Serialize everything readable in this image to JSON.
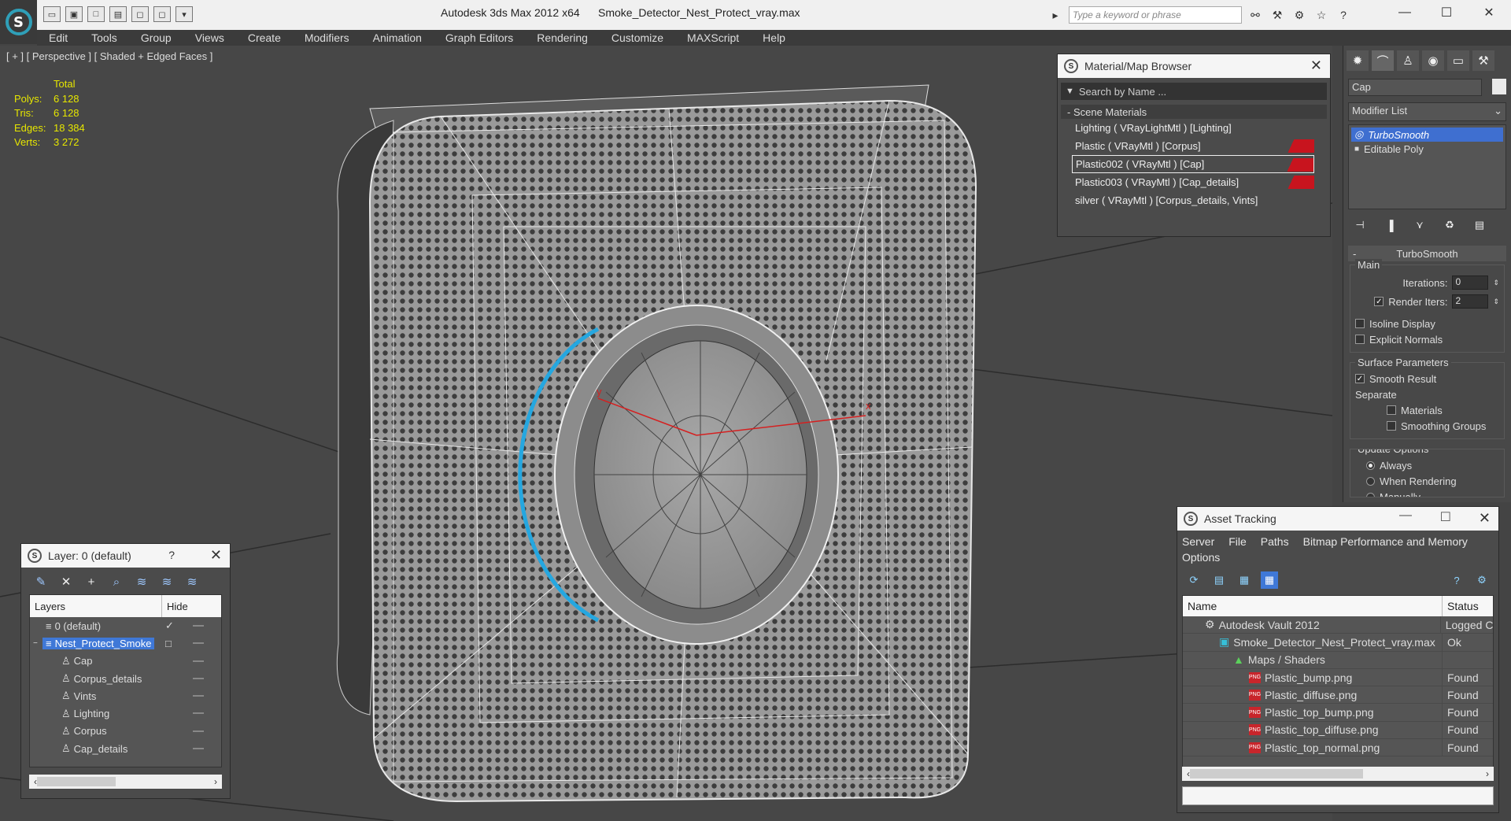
{
  "titlebar": {
    "app": "Autodesk 3ds Max  2012 x64",
    "file": "Smoke_Detector_Nest_Protect_vray.max",
    "search_placeholder": "Type a keyword or phrase",
    "logo_letter": "S"
  },
  "menu": [
    "Edit",
    "Tools",
    "Group",
    "Views",
    "Create",
    "Modifiers",
    "Animation",
    "Graph Editors",
    "Rendering",
    "Customize",
    "MAXScript",
    "Help"
  ],
  "viewport": {
    "label": "[ + ] [ Perspective ] [ Shaded + Edged Faces ]",
    "stats_header": "Total",
    "stats": [
      {
        "k": "Polys:",
        "v": "6 128"
      },
      {
        "k": "Tris:",
        "v": "6 128"
      },
      {
        "k": "Edges:",
        "v": "18 384"
      },
      {
        "k": "Verts:",
        "v": "3 272"
      }
    ],
    "axis_x": "x",
    "axis_y": "y"
  },
  "material_browser": {
    "title": "Material/Map Browser",
    "search_placeholder": "Search by Name ...",
    "section": "- Scene Materials",
    "materials": [
      {
        "label": "Lighting  ( VRayLightMtl )  [Lighting]",
        "swatch": false,
        "selected": false
      },
      {
        "label": "Plastic  ( VRayMtl )  [Corpus]",
        "swatch": true,
        "selected": false
      },
      {
        "label": "Plastic002  ( VRayMtl )  [Cap]",
        "swatch": true,
        "selected": true
      },
      {
        "label": "Plastic003  ( VRayMtl )  [Cap_details]",
        "swatch": true,
        "selected": false
      },
      {
        "label": "silver  ( VRayMtl )  [Corpus_details, Vints]",
        "swatch": false,
        "selected": false
      }
    ]
  },
  "command_panel": {
    "object_name": "Cap",
    "modifier_list": "Modifier List",
    "stack": [
      {
        "label": "TurboSmooth",
        "active": true
      },
      {
        "label": "Editable Poly",
        "active": false
      }
    ],
    "rollout_title": "TurboSmooth",
    "main_label": "Main",
    "iterations_label": "Iterations:",
    "iterations_value": "0",
    "render_iters_label": "Render Iters:",
    "render_iters_value": "2",
    "isoline_label": "Isoline Display",
    "explicit_normals_label": "Explicit Normals",
    "surface_label": "Surface Parameters",
    "smooth_result_label": "Smooth Result",
    "separate_label": "Separate",
    "materials_label": "Materials",
    "smoothing_groups_label": "Smoothing Groups",
    "update_label": "Update Options",
    "always_label": "Always",
    "when_rendering_label": "When Rendering",
    "manually_label": "Manually"
  },
  "layer_panel": {
    "title": "Layer: 0 (default)",
    "help": "?",
    "col_layers": "Layers",
    "col_hide": "Hide",
    "rows": [
      {
        "label": "0 (default)",
        "indent": 1,
        "selected": false,
        "check": "✓"
      },
      {
        "label": "Nest_Protect_Smoke",
        "indent": 1,
        "selected": true,
        "check": "□"
      },
      {
        "label": "Cap",
        "indent": 2,
        "selected": false,
        "check": ""
      },
      {
        "label": "Corpus_details",
        "indent": 2,
        "selected": false,
        "check": ""
      },
      {
        "label": "Vints",
        "indent": 2,
        "selected": false,
        "check": ""
      },
      {
        "label": "Lighting",
        "indent": 2,
        "selected": false,
        "check": ""
      },
      {
        "label": "Corpus",
        "indent": 2,
        "selected": false,
        "check": ""
      },
      {
        "label": "Cap_details",
        "indent": 2,
        "selected": false,
        "check": ""
      }
    ]
  },
  "asset_tracking": {
    "title": "Asset Tracking",
    "menu": [
      "Server",
      "File",
      "Paths",
      "Bitmap Performance and Memory",
      "Options"
    ],
    "col_name": "Name",
    "col_status": "Status",
    "rows": [
      {
        "name": "Autodesk Vault 2012",
        "status": "Logged C",
        "indent": 1,
        "icon": "vault"
      },
      {
        "name": "Smoke_Detector_Nest_Protect_vray.max",
        "status": "Ok",
        "indent": 2,
        "icon": "max"
      },
      {
        "name": "Maps / Shaders",
        "status": "",
        "indent": 3,
        "icon": "maps"
      },
      {
        "name": "Plastic_bump.png",
        "status": "Found",
        "indent": 4,
        "icon": "png"
      },
      {
        "name": "Plastic_diffuse.png",
        "status": "Found",
        "indent": 4,
        "icon": "png"
      },
      {
        "name": "Plastic_top_bump.png",
        "status": "Found",
        "indent": 4,
        "icon": "png"
      },
      {
        "name": "Plastic_top_diffuse.png",
        "status": "Found",
        "indent": 4,
        "icon": "png"
      },
      {
        "name": "Plastic_top_normal.png",
        "status": "Found",
        "indent": 4,
        "icon": "png"
      }
    ]
  },
  "colors": {
    "accent_blue": "#3f78d7",
    "stat_yellow": "#e6e600",
    "swatch_red": "#c8141e"
  }
}
